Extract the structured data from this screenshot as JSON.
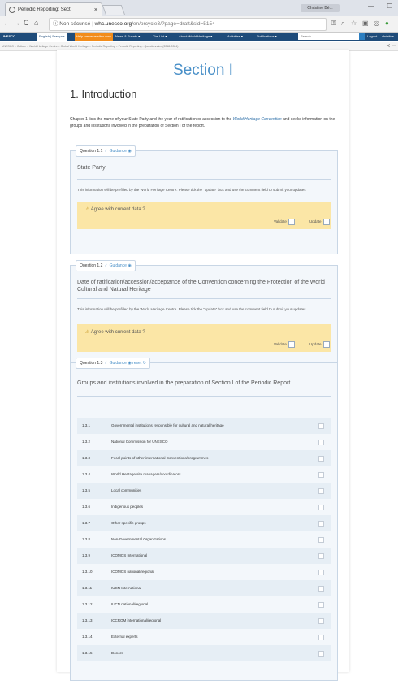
{
  "browser": {
    "tab_title": "Periodic Reporting: Secti",
    "tab_close": "×",
    "user": "Christine Bé...",
    "win_min": "—",
    "win_max": "☐",
    "back": "←",
    "forward": "→",
    "reload": "C",
    "home": "⌂",
    "url_info": "ⓘ Non sécurisé",
    "url_host": "whc.unesco.org",
    "url_path": "/en/prcycle3/?page=draft&sid=5154",
    "star": "☆"
  },
  "topbar": {
    "unesco": "UNESCO",
    "lang": "English | Français",
    "orange": "Help preserve sites now",
    "news": "News & Events ▾",
    "list": "The List ▾",
    "about": "About World Heritage ▾",
    "activities": "Activities ▾",
    "publications": "Publications ▾",
    "search": "Search",
    "logout": "Logout",
    "user": "christine"
  },
  "breadcrumb": "UNESCO » Culture » World Heritage Centre » Global World Heritage » Periodic Reporting » Periodic Reporting - Questionnaire (2018-2024)",
  "share": "≺ ⋯",
  "page": {
    "section_title": "Section I",
    "intro_heading": "1. Introduction",
    "intro_text_1": "Chapter 1 lists the name of your State Party and the year of ratification or accession to the ",
    "intro_link": "World Heritage Convention",
    "intro_text_2": " and seeks information on the groups and institutions involved in the preparation of Section I of the report."
  },
  "q1": {
    "label": "Question 1.1",
    "guidance": "Guidance ◉",
    "title": "State Party",
    "note": "This information will be prefilled by the World Heritage Centre. Please tick the \"update\" box and use the comment field to submit your updates",
    "agree": "Agree with current data ?",
    "validate": "Validate",
    "update": "Update"
  },
  "q2": {
    "label": "Question 1.2",
    "guidance": "Guidance ◉",
    "title": "Date of ratification/accession/acceptance of the Convention concerning the Protection of the World Cultural and Natural Heritage",
    "note": "This information will be prefilled by the World Heritage Centre. Please tick the \"update\" box and use the comment field to submit your updates",
    "agree": "Agree with current data ?",
    "validate": "Validate",
    "update": "Update"
  },
  "q3": {
    "label": "Question 1.3",
    "guidance": "Guidance ◉",
    "reset": "reset ↻",
    "title": "Groups and institutions involved in the preparation of Section I of the Periodic Report",
    "items": [
      {
        "num": "1.3.1",
        "label": "Governmental institutions responsible for cultural and natural heritage"
      },
      {
        "num": "1.3.2",
        "label": "National Commission for UNESCO"
      },
      {
        "num": "1.3.3",
        "label": "Focal points of other international Conventions/programmes"
      },
      {
        "num": "1.3.4",
        "label": "World Heritage site managers/coordinators"
      },
      {
        "num": "1.3.5",
        "label": "Local communities"
      },
      {
        "num": "1.3.6",
        "label": "Indigenous peoples"
      },
      {
        "num": "1.3.7",
        "label": "Other specific groups"
      },
      {
        "num": "1.3.8",
        "label": "Non-Governmental Organizations"
      },
      {
        "num": "1.3.9",
        "label": "ICOMOS International"
      },
      {
        "num": "1.3.10",
        "label": "ICOMOS national/regional"
      },
      {
        "num": "1.3.11",
        "label": "IUCN International"
      },
      {
        "num": "1.3.12",
        "label": "IUCN national/regional"
      },
      {
        "num": "1.3.13",
        "label": "ICCROM international/regional"
      },
      {
        "num": "1.3.14",
        "label": "External experts"
      },
      {
        "num": "1.3.15",
        "label": "Donors"
      }
    ]
  }
}
